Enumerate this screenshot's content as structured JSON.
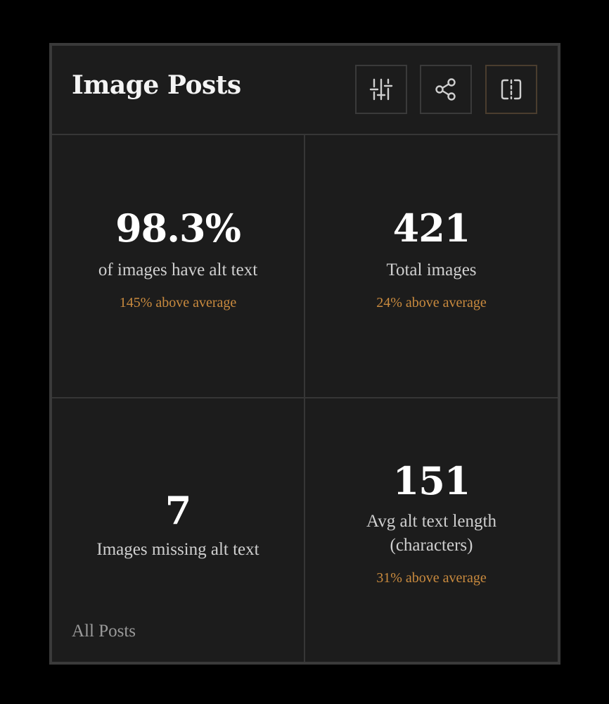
{
  "header": {
    "title": "Image Posts",
    "buttons": [
      {
        "name": "filter",
        "icon": "sliders-icon"
      },
      {
        "name": "share",
        "icon": "share-icon"
      },
      {
        "name": "split",
        "icon": "split-view-icon"
      }
    ]
  },
  "stats": [
    {
      "value": "98.3%",
      "label": "of images have alt text",
      "delta": "145% above average"
    },
    {
      "value": "421",
      "label": "Total images",
      "delta": "24% above average"
    },
    {
      "value": "7",
      "label": "Images missing alt text",
      "delta": ""
    },
    {
      "value": "151",
      "label_line1": "Avg alt text length",
      "label_line2": "(characters)",
      "delta": "31% above average"
    }
  ],
  "footer": {
    "link": "All Posts"
  },
  "colors": {
    "background": "#000000",
    "card": "#1c1c1c",
    "border": "#3a3a3a",
    "accent": "#c98a3e",
    "text_primary": "#ffffff",
    "text_secondary": "#cfcfcf"
  }
}
